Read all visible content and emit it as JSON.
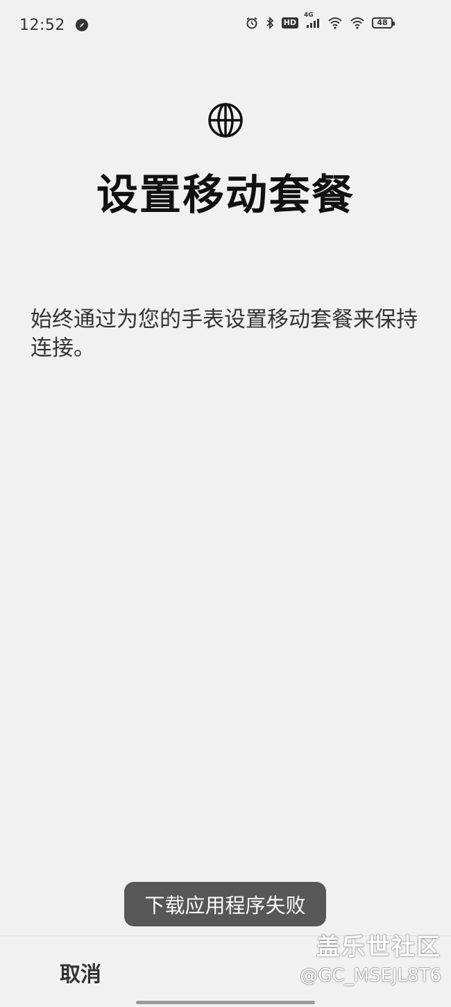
{
  "status_bar": {
    "time": "12:52",
    "network_label": "4G",
    "hd_label": "HD",
    "battery_level": "48",
    "icons": [
      "compass-icon",
      "alarm-icon",
      "bluetooth-icon",
      "hd-icon",
      "signal-icon",
      "wifi-icon",
      "wifi-icon",
      "battery-icon"
    ]
  },
  "header": {
    "icon": "globe-icon",
    "title": "设置移动套餐"
  },
  "main": {
    "description": "始终通过为您的手表设置移动套餐来保持连接。"
  },
  "toast": {
    "message": "下载应用程序失败"
  },
  "footer": {
    "cancel_label": "取消"
  },
  "watermark": {
    "brand": "盖乐世社区",
    "user": "@GC_MSEJL8T6"
  },
  "colors": {
    "background": "#f1f1f1",
    "toast_bg": "#575757",
    "text_primary": "#111111"
  }
}
